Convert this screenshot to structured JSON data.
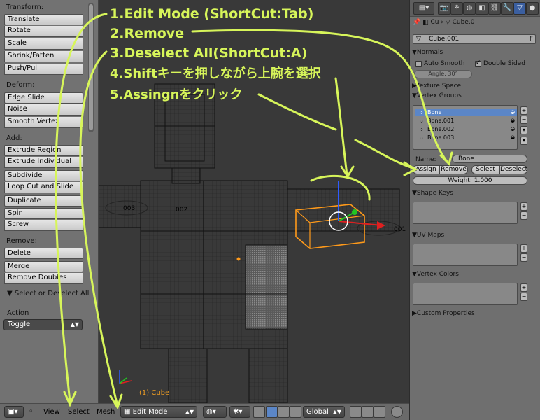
{
  "tool_shelf": {
    "transform": {
      "label": "Transform:",
      "buttons": [
        "Translate",
        "Rotate",
        "Scale",
        "Shrink/Fatten",
        "Push/Pull"
      ]
    },
    "deform": {
      "label": "Deform:",
      "buttons": [
        "Edge Slide",
        "Noise",
        "Smooth Vertex"
      ]
    },
    "add": {
      "label": "Add:",
      "buttons": [
        "Extrude Region",
        "Extrude Individual",
        "Subdivide",
        "Loop Cut and Slide",
        "Duplicate",
        "Spin",
        "Screw"
      ]
    },
    "remove": {
      "label": "Remove:",
      "buttons": [
        "Delete",
        "Merge",
        "Remove Doubles"
      ]
    },
    "operator_panel": {
      "title": "Select or Deselect All",
      "action_label": "Action",
      "action_value": "Toggle"
    }
  },
  "viewport": {
    "object_label": "(1) Cube",
    "bone_labels": [
      "003",
      "002",
      "001"
    ]
  },
  "bottom_header": {
    "menu": [
      "View",
      "Select",
      "Mesh"
    ],
    "mode": "Edit Mode",
    "orientation": "Global"
  },
  "properties": {
    "breadcrumb": {
      "a": "Cu",
      "b": "Cube.0"
    },
    "mesh_name": "Cube.001",
    "mesh_name_suffix": "F",
    "normals": {
      "header": "Normals",
      "auto_smooth": "Auto Smooth",
      "double_sided": "Double Sided",
      "angle": "Angle: 30°"
    },
    "texture_space": "Texture Space",
    "vertex_groups": {
      "header": "Vertex Groups",
      "items": [
        "Bone",
        "Bone.001",
        "Bone.002",
        "Bone.003"
      ],
      "name_label": "Name:",
      "name_value": "Bone",
      "assign": "Assign",
      "remove": "Remove",
      "select": "Select",
      "deselect": "Deselect",
      "weight": "Weight: 1.000"
    },
    "shape_keys": "Shape Keys",
    "uv_maps": "UV Maps",
    "vertex_colors": "Vertex Colors",
    "custom_properties": "Custom Properties"
  },
  "annotations": {
    "step1": "1.Edit Mode (ShortCut:Tab)",
    "step2": "2.Remove",
    "step3": "3.Deselect All(ShortCut:A)",
    "step4": "4.Shiftキーを押しながら上腕を選択",
    "step5": "5.Assingnをクリック"
  },
  "colors": {
    "annotation": "#d7f55a",
    "selection": "#ff9a1a",
    "active_tab": "#3b5fa0"
  }
}
